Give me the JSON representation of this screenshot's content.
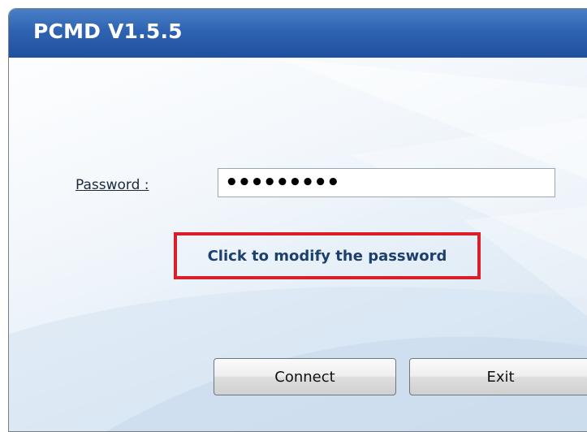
{
  "window": {
    "title": "PCMD V1.5.5"
  },
  "form": {
    "password_label": "Password :",
    "password_value": "•••••••••"
  },
  "links": {
    "modify_password": "Click to modify the password"
  },
  "buttons": {
    "connect": "Connect",
    "exit": "Exit"
  },
  "colors": {
    "titlebar": "#2f63b2",
    "highlight_border": "#d9202a",
    "link_text": "#1c3f6e"
  }
}
